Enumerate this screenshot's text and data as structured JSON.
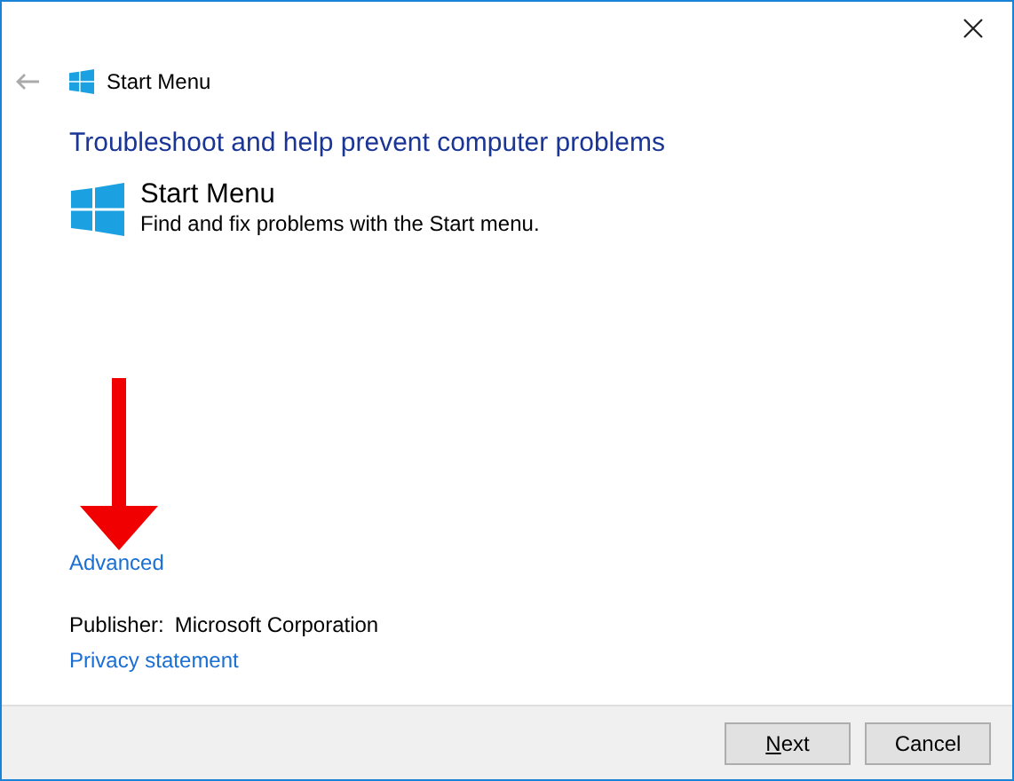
{
  "window": {
    "title": "Start Menu",
    "back_disabled": true
  },
  "heading": "Troubleshoot and help prevent computer problems",
  "troubleshooter": {
    "name": "Start Menu",
    "description": "Find and fix problems with the Start menu."
  },
  "annotation": {
    "kind": "arrow"
  },
  "advanced_link": "Advanced",
  "publisher": {
    "label": "Publisher:",
    "value": "Microsoft Corporation"
  },
  "privacy_link": "Privacy statement",
  "buttons": [
    {
      "label": "Next",
      "first_letter_underlined": true
    },
    {
      "label": "Cancel"
    }
  ]
}
